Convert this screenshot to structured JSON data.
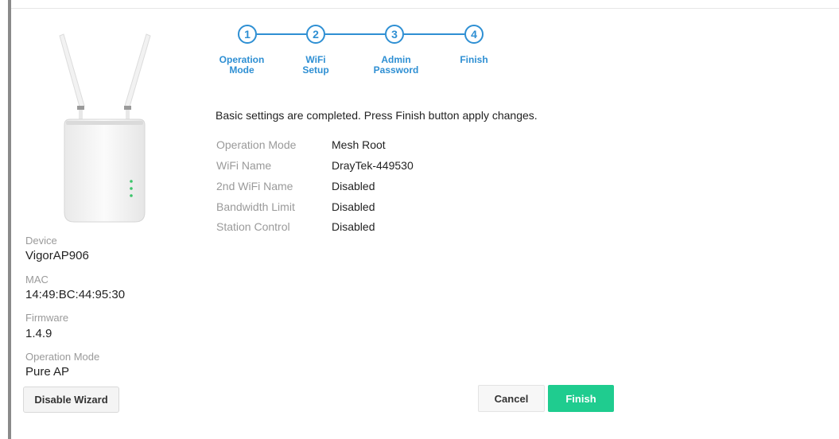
{
  "stepper": {
    "steps": [
      {
        "number": "1",
        "label_line1": "Operation",
        "label_line2": "Mode"
      },
      {
        "number": "2",
        "label_line1": "WiFi",
        "label_line2": "Setup"
      },
      {
        "number": "3",
        "label_line1": "Admin",
        "label_line2": "Password"
      },
      {
        "number": "4",
        "label_line1": "Finish",
        "label_line2": ""
      }
    ],
    "active_color": "#2e8fd3"
  },
  "device_info": {
    "device_label": "Device",
    "device_value": "VigorAP906",
    "mac_label": "MAC",
    "mac_value": "14:49:BC:44:95:30",
    "firmware_label": "Firmware",
    "firmware_value": "1.4.9",
    "opmode_label": "Operation Mode",
    "opmode_value": "Pure AP",
    "disable_wizard_label": "Disable Wizard"
  },
  "summary": {
    "message": "Basic settings are completed. Press Finish button apply changes.",
    "rows": [
      {
        "key": "Operation Mode",
        "value": "Mesh Root"
      },
      {
        "key": "WiFi Name",
        "value": "DrayTek-449530"
      },
      {
        "key": "2nd WiFi Name",
        "value": "Disabled"
      },
      {
        "key": "Bandwidth Limit",
        "value": "Disabled"
      },
      {
        "key": "Station Control",
        "value": "Disabled"
      }
    ]
  },
  "actions": {
    "cancel_label": "Cancel",
    "finish_label": "Finish",
    "finish_color": "#1fcc8f"
  },
  "icons": {
    "device_image": "access-point-device-icon"
  }
}
